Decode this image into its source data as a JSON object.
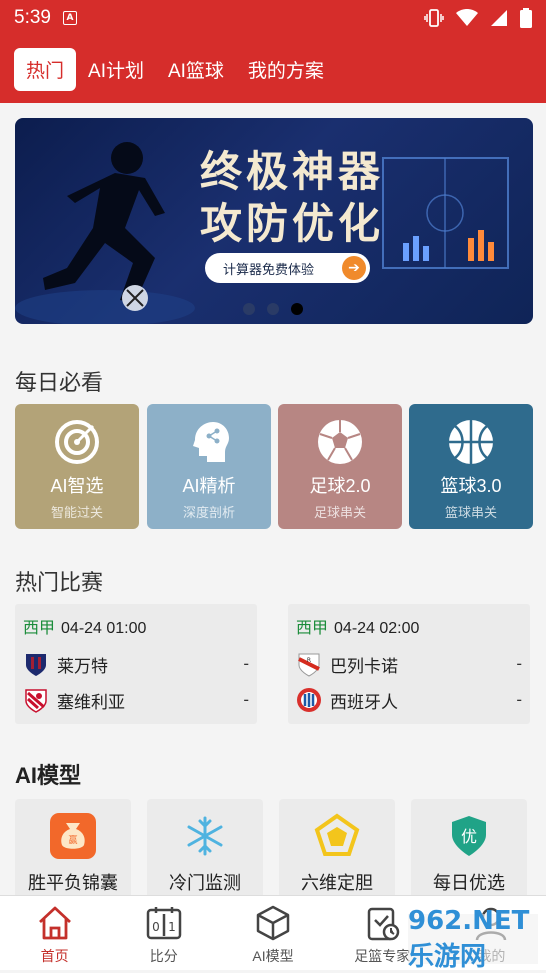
{
  "status_bar": {
    "time": "5:39",
    "notification_icon": "A"
  },
  "top_tabs": [
    {
      "label": "热门",
      "active": true
    },
    {
      "label": "AI计划",
      "active": false
    },
    {
      "label": "AI篮球",
      "active": false
    },
    {
      "label": "我的方案",
      "active": false
    }
  ],
  "banner": {
    "line1": "终极神器",
    "line2": "攻防优化",
    "cta": "计算器免费体验",
    "active_dot": 3,
    "dot_count": 3
  },
  "daily": {
    "title": "每日必看",
    "cards": [
      {
        "title": "AI智选",
        "subtitle": "智能过关",
        "color": "#b3a378",
        "icon": "target-icon"
      },
      {
        "title": "AI精析",
        "subtitle": "深度剖析",
        "color": "#8db0c8",
        "icon": "brain-head-icon"
      },
      {
        "title": "足球2.0",
        "subtitle": "足球串关",
        "color": "#b78683",
        "icon": "soccer-ball-icon"
      },
      {
        "title": "篮球3.0",
        "subtitle": "篮球串关",
        "color": "#2f6b8d",
        "icon": "basketball-icon"
      }
    ]
  },
  "hot_matches": {
    "title": "热门比赛",
    "matches": [
      {
        "league": "西甲",
        "time": "04-24 01:00",
        "home": {
          "name": "莱万特",
          "score": "-"
        },
        "away": {
          "name": "塞维利亚",
          "score": "-"
        }
      },
      {
        "league": "西甲",
        "time": "04-24 02:00",
        "home": {
          "name": "巴列卡诺",
          "score": "-"
        },
        "away": {
          "name": "西班牙人",
          "score": "-"
        }
      }
    ]
  },
  "ai_models": {
    "title": "AI模型",
    "items": [
      {
        "label": "胜平负锦囊",
        "icon": "money-bag-icon"
      },
      {
        "label": "冷门监测",
        "icon": "snowflake-icon"
      },
      {
        "label": "六维定胆",
        "icon": "pentagon-radar-icon"
      },
      {
        "label": "每日优选",
        "icon": "shield-badge-icon"
      }
    ]
  },
  "bottom_nav": [
    {
      "label": "首页",
      "active": true,
      "icon": "home-icon"
    },
    {
      "label": "比分",
      "active": false,
      "icon": "scoreboard-icon"
    },
    {
      "label": "AI模型",
      "active": false,
      "icon": "cube-icon"
    },
    {
      "label": "足篮专家",
      "active": false,
      "icon": "clipboard-check-icon"
    },
    {
      "label": "我的",
      "active": false,
      "icon": "user-icon"
    }
  ],
  "watermark": "962.NET 乐游网",
  "colors": {
    "brand_red": "#d62d2b",
    "league_green": "#1a8c3a"
  }
}
